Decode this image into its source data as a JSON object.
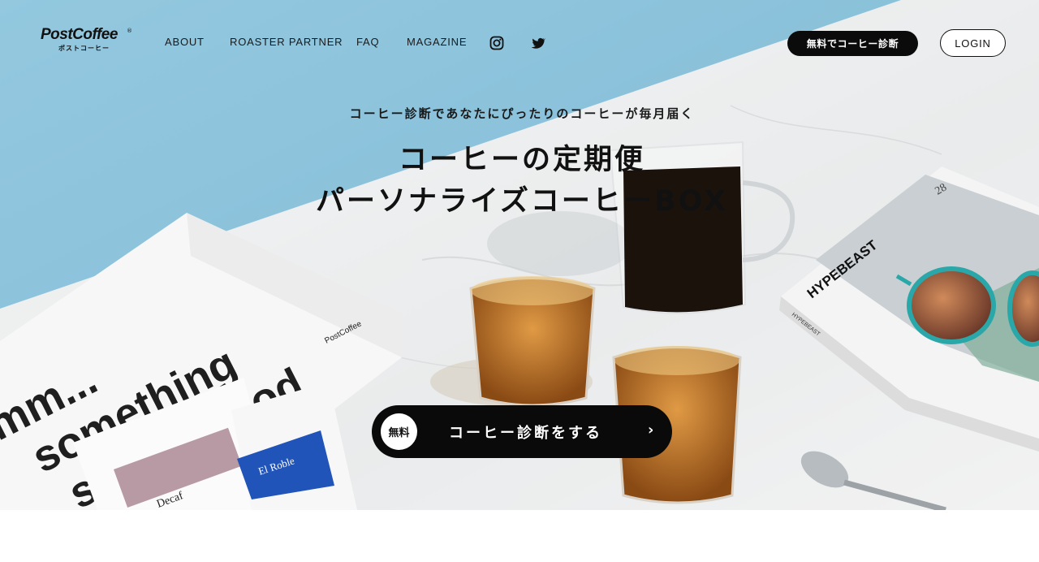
{
  "header": {
    "logo": {
      "wordmark": "PostCoffee",
      "reg": "®",
      "kana": "ポストコーヒー"
    },
    "nav": [
      {
        "label": "ABOUT"
      },
      {
        "label": "ROASTER PARTNER"
      },
      {
        "label": "FAQ"
      },
      {
        "label": "MAGAZINE"
      }
    ],
    "social": [
      {
        "icon": "instagram-icon"
      },
      {
        "icon": "twitter-icon"
      }
    ],
    "diagnosis_button": "無料でコーヒー診断",
    "login_button": "LOGIN"
  },
  "hero": {
    "subtitle": "コーヒー診断であなたにぴったりのコーヒーが毎月届く",
    "title_line1": "コーヒーの定期便",
    "title_line2": "パーソナライズコーヒーBOX",
    "cta": {
      "badge": "無料",
      "label": "コーヒー診断をする",
      "chevron": "›"
    },
    "photo_text": {
      "box_brand": "PostCoffee",
      "box_slogan_1": "mm...",
      "box_slogan_2": "something",
      "box_slogan_3": "smells good",
      "bag_1": "Decaf",
      "bag_2": "El Roble",
      "magazine": "HYPEBEAST",
      "magazine_spine": "HYPEBEAST",
      "magazine_issue": "28"
    }
  },
  "colors": {
    "sky": "#8cc3dd",
    "accent_dark": "#0b0b0b",
    "bag_blue": "#2154b8",
    "bag_mauve": "#b89aa4",
    "glasses_teal": "#2aa7a8"
  }
}
